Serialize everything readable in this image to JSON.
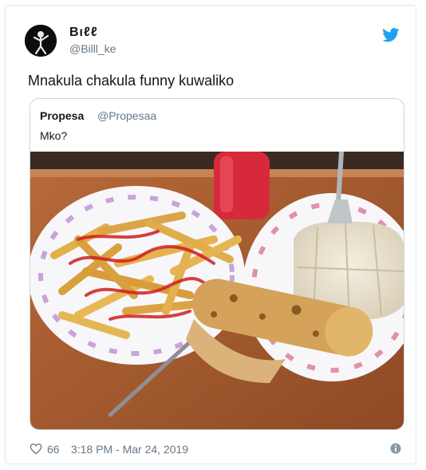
{
  "tweet": {
    "display_name": "Bιℓℓ",
    "handle": "@Billl_ke",
    "text": "Mnakula chakula funny kuwaliko",
    "likes": "66",
    "timestamp": "3:18 PM - Mar 24, 2019"
  },
  "quoted_tweet": {
    "display_name": "Propesa",
    "handle": "@Propesaa",
    "text": "Mko?",
    "photo": "plate of fries with sauce, chapati and ugali on a table"
  },
  "icons": {
    "brand": "twitter-bird-icon",
    "like": "heart-icon",
    "info": "info-icon"
  },
  "colors": {
    "twitter_blue": "#1da1f2",
    "secondary_text": "#657786",
    "border": "#e1e8ed"
  }
}
